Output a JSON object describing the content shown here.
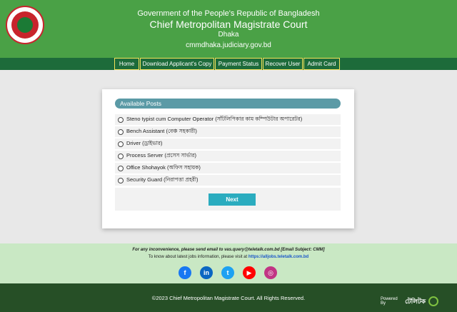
{
  "header": {
    "line1": "Government of the People's Republic of Bangladesh",
    "line2": "Chief Metropolitan Magistrate Court",
    "line3": "Dhaka",
    "line4": "cmmdhaka.judiciary.gov.bd",
    "logo_icon": "bangladesh-government-seal"
  },
  "nav": {
    "items": [
      {
        "label": "Home"
      },
      {
        "label": "Download Applicant's Copy"
      },
      {
        "label": "Payment Status"
      },
      {
        "label": "Recover User"
      },
      {
        "label": "Admit Card"
      }
    ]
  },
  "posts": {
    "title": "Available Posts",
    "items": [
      {
        "label": "Steno typist cum Computer Operator (সাঁটলিপিকার কাম কম্পিউটার অপারেটর)"
      },
      {
        "label": "Bench Assistant (বেঞ্চ সহকারী)"
      },
      {
        "label": "Driver (ড্রাইভার)"
      },
      {
        "label": "Process Server (প্রসেস সার্ভার)"
      },
      {
        "label": "Office Shohayok (অফিস সহায়ক)"
      },
      {
        "label": "Security Guard (নিরাপত্তা প্রহরী)"
      }
    ],
    "next_label": "Next"
  },
  "footer": {
    "inconvenience_text": "For any inconvenience, please send email to vas.query@teletalk.com.bd [Email Subject: CMM]",
    "jobs_text": "To know about latest jobs information, please visit at",
    "jobs_link": "https://alljobs.teletalk.com.bd",
    "socials": [
      {
        "icon": "facebook-icon",
        "glyph": "f",
        "color": "#1877f2"
      },
      {
        "icon": "linkedin-icon",
        "glyph": "in",
        "color": "#0a66c2"
      },
      {
        "icon": "twitter-icon",
        "glyph": "t",
        "color": "#1da1f2"
      },
      {
        "icon": "youtube-icon",
        "glyph": "▶",
        "color": "#ff0000"
      },
      {
        "icon": "instagram-icon",
        "glyph": "◎",
        "color": "#c13584"
      }
    ],
    "copyright": "©2023 Chief Metropolitan Magistrate Court. All Rights Reserved.",
    "powered_by": "Powered By",
    "teletalk_logo_text": "টেলিটক"
  }
}
